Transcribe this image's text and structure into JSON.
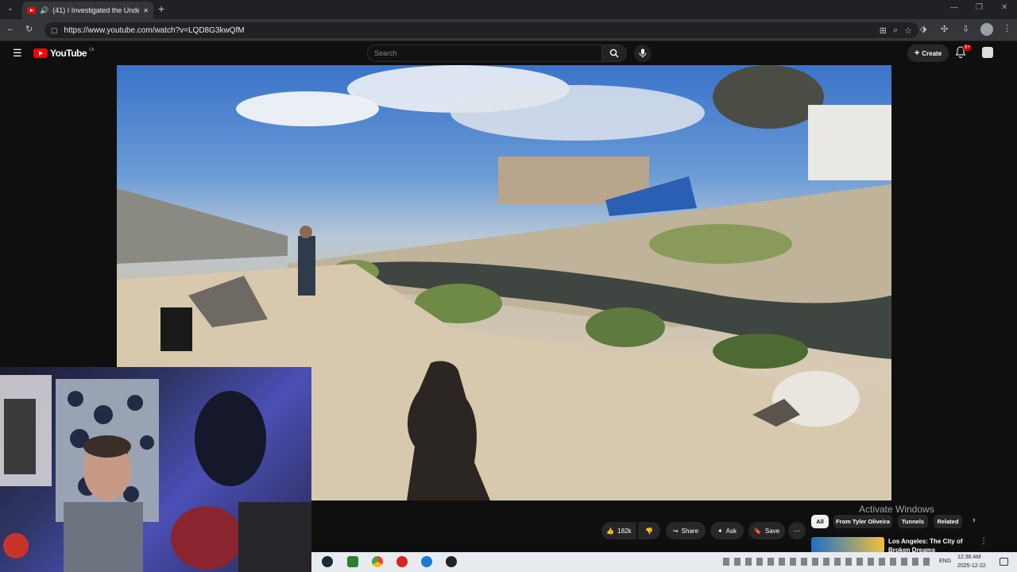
{
  "browser": {
    "tab_title": "(41) I Investigated the Unde",
    "url": "https://www.youtube.com/watch?v=LQD8G3kwQfM",
    "new_tab_symbol": "+",
    "close_symbol": "✕"
  },
  "youtube": {
    "logo_text": "YouTube",
    "region": "CA",
    "search_placeholder": "Search",
    "create_label": "Create",
    "notification_count": "9+"
  },
  "actions": {
    "like_count": "182k",
    "share_label": "Share",
    "ask_label": "Ask",
    "save_label": "Save",
    "more_label": "⋯"
  },
  "filter_chips": [
    "All",
    "From Tyler Oliveira",
    "Tunnels",
    "Related"
  ],
  "suggestion": {
    "title": "Los Angeles: The City of Broken Dreams"
  },
  "watermark": "Activate Windows",
  "taskbar": {
    "lang": "ENG",
    "time": "12:38 AM",
    "date": "2025-12-22"
  }
}
